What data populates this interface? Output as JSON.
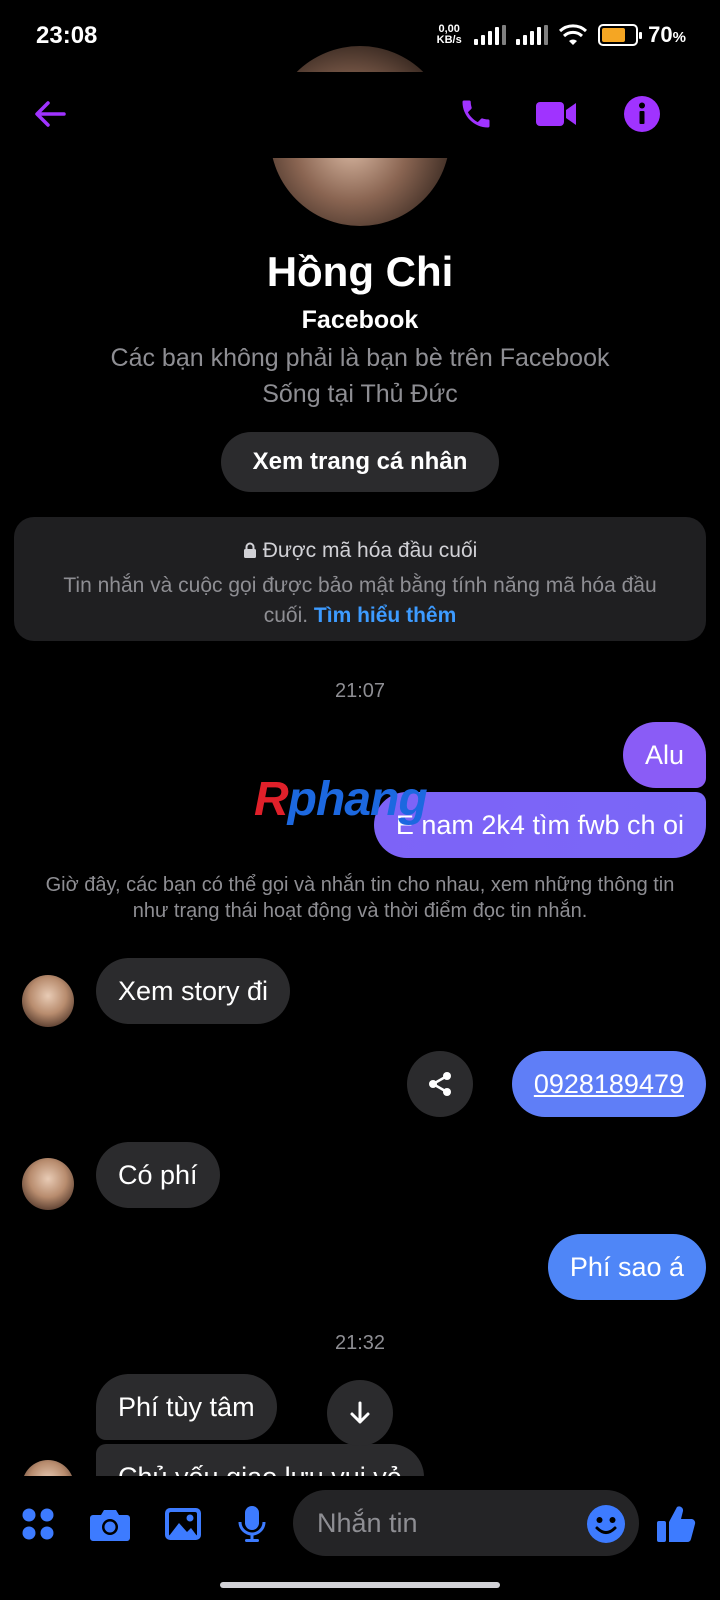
{
  "status_bar": {
    "time": "23:08",
    "net_speed_value": "0,00",
    "net_speed_unit": "KB/s",
    "battery_percent": "70",
    "battery_suffix": "%"
  },
  "header": {
    "icons": [
      "back-arrow-icon",
      "phone-icon",
      "video-camera-icon",
      "info-icon"
    ],
    "accent_color": "#a033ff"
  },
  "profile": {
    "name": "Hồng Chi",
    "platform": "Facebook",
    "friendship": "Các bạn không phải là bạn bè trên Facebook",
    "location": "Sống tại Thủ Đức",
    "view_profile_label": "Xem trang cá nhân"
  },
  "encryption": {
    "title": "Được mã hóa đầu cuối",
    "description": "Tin nhắn và cuộc gọi được bảo mật bằng tính năng mã hóa đầu cuối.",
    "learn_more": "Tìm hiểu thêm"
  },
  "conversation": {
    "timestamp_1": "21:07",
    "msg_alu": "Alu",
    "msg_intro": "E nam 2k4 tìm fwb ch oi",
    "system_note": "Giờ đây, các bạn có thể gọi và nhắn tin cho nhau, xem những thông tin như trạng thái hoạt động và thời điểm đọc tin nhắn.",
    "msg_story": "Xem story đi",
    "msg_phone": "0928189479",
    "msg_fee": "Có phí",
    "msg_fee_question": "Phí sao á",
    "timestamp_2": "21:32",
    "msg_fee_answer": "Phí tùy tâm",
    "msg_partial": "Chủ yếu giao lưu vui vẻ"
  },
  "watermark": {
    "first": "R",
    "rest": "phang"
  },
  "composer": {
    "placeholder": "Nhắn tin",
    "icons": [
      "apps-grid-icon",
      "camera-icon",
      "image-icon",
      "microphone-icon",
      "emoji-icon",
      "thumbs-up-icon"
    ],
    "accent_color": "#3d7bff"
  },
  "colors": {
    "bubble_out_top": "#8a5cf6",
    "bubble_out_bottom": "#4f86f7",
    "bubble_in": "#2b2b2d"
  }
}
